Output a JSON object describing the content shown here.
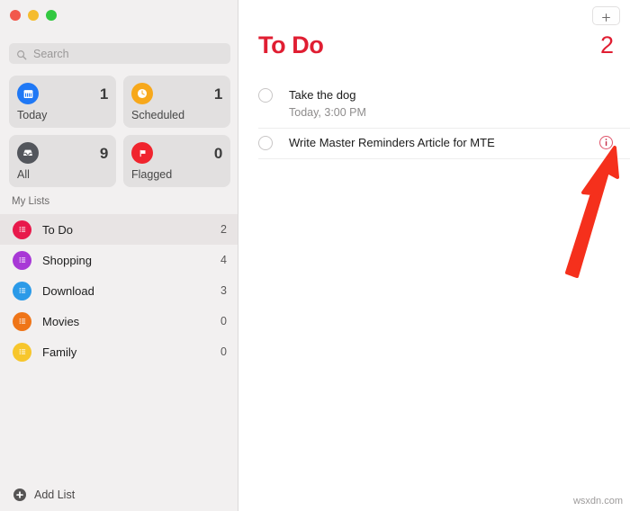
{
  "window": {
    "traffic_lights": [
      {
        "name": "close",
        "color": "#f2584c"
      },
      {
        "name": "minimize",
        "color": "#f5bc2e"
      },
      {
        "name": "maximize",
        "color": "#32c840"
      }
    ]
  },
  "sidebar": {
    "search": {
      "value": "",
      "placeholder": "Search",
      "icon": "search-icon"
    },
    "smart_lists": [
      {
        "label": "Today",
        "count": "1",
        "icon": "calendar-icon",
        "color": "#1f78f5"
      },
      {
        "label": "Scheduled",
        "count": "1",
        "icon": "clock-icon",
        "color": "#f7a81b"
      },
      {
        "label": "All",
        "count": "9",
        "icon": "inbox-icon",
        "color": "#53565c"
      },
      {
        "label": "Flagged",
        "count": "0",
        "icon": "flag-icon",
        "color": "#f0242e"
      }
    ],
    "section_title": "My Lists",
    "lists": [
      {
        "label": "To Do",
        "count": "2",
        "color": "#e8194b",
        "selected": true
      },
      {
        "label": "Shopping",
        "count": "4",
        "color": "#a838d6",
        "selected": false
      },
      {
        "label": "Download",
        "count": "3",
        "color": "#2b9ae8",
        "selected": false
      },
      {
        "label": "Movies",
        "count": "0",
        "color": "#ef7518",
        "selected": false
      },
      {
        "label": "Family",
        "count": "0",
        "color": "#f7c62c",
        "selected": false
      }
    ],
    "add_list": {
      "label": "Add List",
      "icon": "plus-circle-icon"
    }
  },
  "main": {
    "add_reminder_label": "+",
    "title": "To Do",
    "count": "2",
    "accent_color": "#e01e32",
    "reminders": [
      {
        "title": "Take the dog",
        "subtitle": "Today, 3:00 PM",
        "completed": false,
        "has_info": false
      },
      {
        "title": "Write Master Reminders Article for MTE",
        "subtitle": "",
        "completed": false,
        "has_info": true
      }
    ]
  },
  "annotation": {
    "arrow_color": "#f5301c",
    "points_to": "info-icon"
  },
  "watermark": "wsxdn.com"
}
